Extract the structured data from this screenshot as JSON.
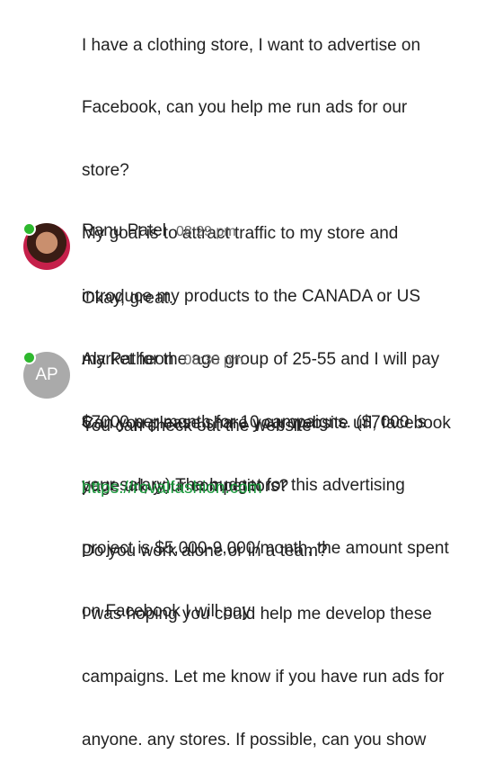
{
  "messages": [
    {
      "lines": [
        "I have a clothing store, I want to advertise on",
        "Facebook, can you help me run ads for our",
        "store?",
        "My goal is to attract traffic to my store and",
        "introduce my products to the CANADA or US",
        "market for the age group of 25-55 and I will pay",
        "$7000 per month for 10 campaigns. ($7000 is",
        "your salary) The budget for this advertising",
        "project is $5,000-9,000/month, the amount spent",
        "on Facebook I will pay"
      ]
    },
    {
      "sender": "Ranu Patel",
      "time": "08:29 pm",
      "lines": [
        "Okay, great.",
        "",
        "Can you please share your website url, facebook",
        "page url, your competitors?"
      ]
    },
    {
      "sender": "Aly Patheon",
      "time": "08:30 pm",
      "avatar_initials": "AP",
      "line1": "You can check out the website",
      "link": "https://rovalfashion.com",
      "lines": [
        "Do you work alone or in a team?",
        "I was hoping you could help me develop these",
        "campaigns. Let me know if you have run ads for",
        "anyone. any stores. If possible, can you show"
      ]
    }
  ],
  "colors": {
    "online": "#2eb82e",
    "link": "#1a9a3c",
    "avatar_bg": "#aaaaaa"
  }
}
